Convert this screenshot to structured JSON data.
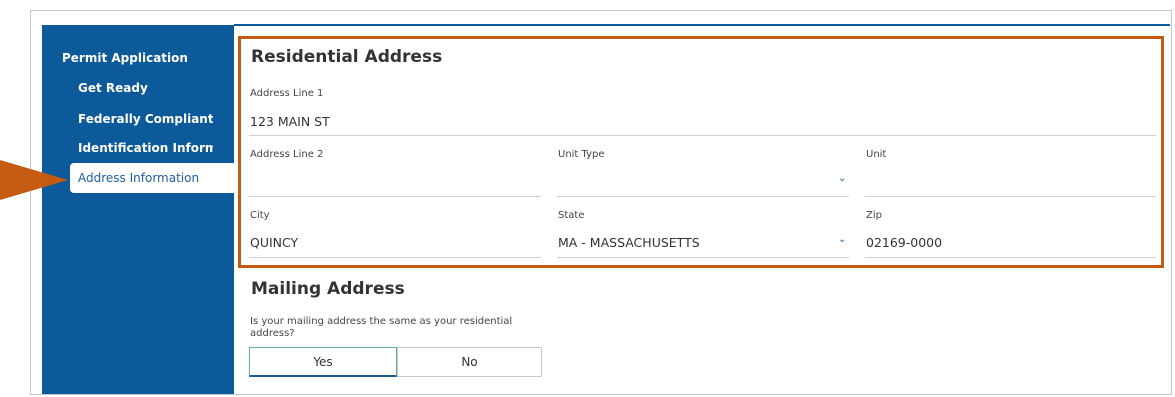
{
  "sidebar": {
    "title": "Permit Application",
    "items": [
      {
        "label": "Get Ready"
      },
      {
        "label": "Federally Compliant ID"
      },
      {
        "label": "Identification Information"
      },
      {
        "label": "Address Information"
      }
    ]
  },
  "residential": {
    "heading": "Residential Address",
    "address_line1": {
      "label": "Address Line 1",
      "value": "123 MAIN ST"
    },
    "address_line2": {
      "label": "Address Line 2",
      "value": ""
    },
    "unit_type": {
      "label": "Unit Type",
      "value": ""
    },
    "unit": {
      "label": "Unit",
      "value": ""
    },
    "city": {
      "label": "City",
      "value": "QUINCY"
    },
    "state": {
      "label": "State",
      "value": "MA - MASSACHUSETTS"
    },
    "zip": {
      "label": "Zip",
      "value": "02169-0000"
    }
  },
  "mailing": {
    "heading": "Mailing Address",
    "question": "Is your mailing address the same as your residential address?",
    "yes_label": "Yes",
    "no_label": "No"
  },
  "colors": {
    "sidebar": "#0c5a99",
    "highlight": "#c55a11",
    "active_link": "#1f5fa8"
  }
}
